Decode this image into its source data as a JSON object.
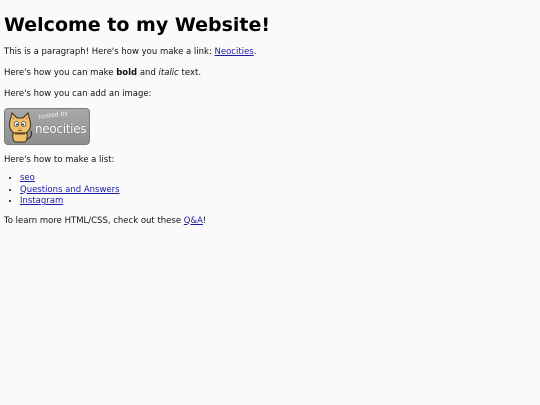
{
  "heading": "Welcome to my Website!",
  "para1": {
    "before": "This is a paragraph! Here's how you make a link: ",
    "link": "Neocities",
    "after": "."
  },
  "para2": {
    "before": "Here's how you can make ",
    "bold": "bold",
    "middle": " and ",
    "italic": "italic",
    "after": " text."
  },
  "para3": "Here's how you can add an image:",
  "badge": {
    "hosted": "hosted by",
    "name": "neocities",
    "icon": "neocities-cat-icon"
  },
  "para4": "Here's how to make a list:",
  "list": [
    "seo",
    "Questions and Answers",
    "Instagram"
  ],
  "para5": {
    "before": "To learn more HTML/CSS, check out these ",
    "link": "Q&A",
    "after": "!"
  },
  "colors": {
    "link": "#1a1aa6",
    "background": "#fafafa",
    "badge": "#9a9a9a"
  }
}
